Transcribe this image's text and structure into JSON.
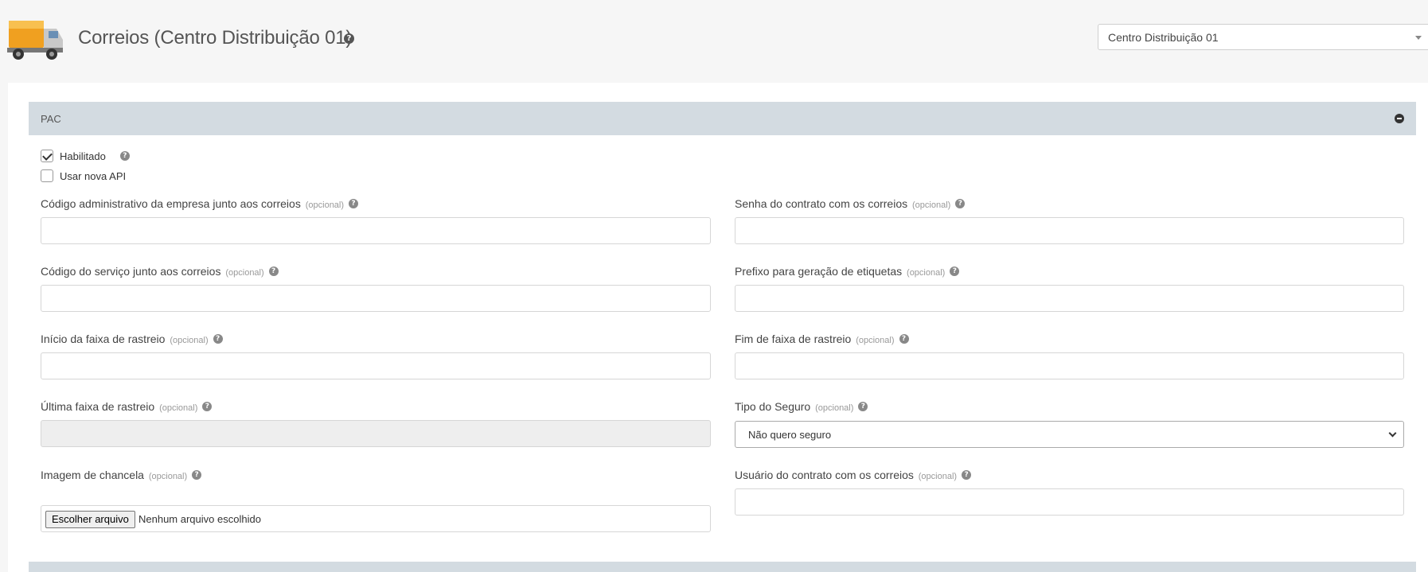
{
  "header": {
    "title": "Correios (Centro Distribuição 01)",
    "help_icon": "question-circle-icon",
    "distribution_select_value": "Centro Distribuição 01"
  },
  "section": {
    "title": "PAC",
    "collapse_icon": "minus-circle-icon"
  },
  "checkboxes": {
    "habilitado": {
      "label": "Habilitado",
      "checked": true
    },
    "nova_api": {
      "label": "Usar nova API",
      "checked": false
    }
  },
  "fields": {
    "codigo_admin": {
      "label": "Código administrativo da empresa junto aos correios",
      "optional": "(opcional)",
      "value": ""
    },
    "senha_contrato": {
      "label": "Senha do contrato com os correios",
      "optional": "(opcional)",
      "value": ""
    },
    "codigo_servico": {
      "label": "Código do serviço junto aos correios",
      "optional": "(opcional)",
      "value": ""
    },
    "prefixo_etiquetas": {
      "label": "Prefixo para geração de etiquetas",
      "optional": "(opcional)",
      "value": ""
    },
    "inicio_faixa": {
      "label": "Início da faixa de rastreio",
      "optional": "(opcional)",
      "value": ""
    },
    "fim_faixa": {
      "label": "Fim de faixa de rastreio",
      "optional": "(opcional)",
      "value": ""
    },
    "ultima_faixa": {
      "label": "Última faixa de rastreio",
      "optional": "(opcional)",
      "value": ""
    },
    "tipo_seguro": {
      "label": "Tipo do Seguro",
      "optional": "(opcional)",
      "value": "Não quero seguro"
    },
    "imagem_chancela": {
      "label": "Imagem de chancela",
      "optional": "(opcional)",
      "button": "Escolher arquivo",
      "file_status": "Nenhum arquivo escolhido"
    },
    "usuario_contrato": {
      "label": "Usuário do contrato com os correios",
      "optional": "(opcional)",
      "value": ""
    }
  },
  "colors": {
    "section_bar": "#d3dbe1",
    "background": "#f6f6f6",
    "truck_orange": "#f5a623"
  }
}
